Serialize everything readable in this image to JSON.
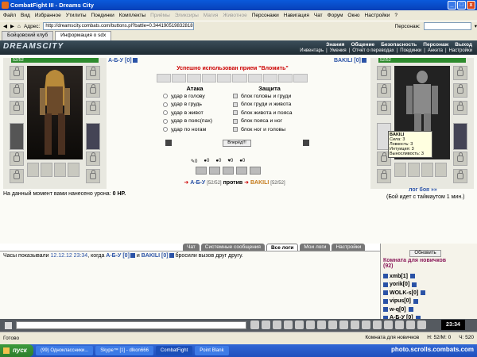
{
  "window": {
    "title": "CombatFight III - Dreams City",
    "minimize": "_",
    "maximize": "□",
    "close": "x"
  },
  "menu": [
    {
      "label": "Файл",
      "dim": false
    },
    {
      "label": "Вид",
      "dim": false
    },
    {
      "label": "Избранное",
      "dim": false
    },
    {
      "label": "Утилиты",
      "dim": false
    },
    {
      "label": "Поединки",
      "dim": false
    },
    {
      "label": "Комплекты",
      "dim": false
    },
    {
      "label": "Приёмы",
      "dim": true
    },
    {
      "label": "Эликсиры",
      "dim": true
    },
    {
      "label": "Магия",
      "dim": true
    },
    {
      "label": "Животное",
      "dim": true
    },
    {
      "label": "Персонажи",
      "dim": false
    },
    {
      "label": "Навигация",
      "dim": false
    },
    {
      "label": "Чат",
      "dim": false
    },
    {
      "label": "Форум",
      "dim": false
    },
    {
      "label": "Окно",
      "dim": false
    },
    {
      "label": "Настройки",
      "dim": false
    },
    {
      "label": "?",
      "dim": false
    }
  ],
  "address": {
    "label": "Адрес:",
    "url": "http://dreamscity.combats.com/buttons.pl?battle=0.344190519832818",
    "persons_label": "Персонаж:"
  },
  "tabs": [
    {
      "label": "Бойцовский клуб"
    },
    {
      "label": "Информация о sdx"
    }
  ],
  "game": {
    "logo": "DREAMSCITY",
    "nav_top": [
      "Знания",
      "Общение",
      "Безопасность",
      "Персонаж",
      "Выход"
    ],
    "nav_sub": [
      "Инвентарь",
      "Умения",
      "Отчет о переводах",
      "Поединки",
      "Анкета",
      "Настройки"
    ]
  },
  "left_player": {
    "name": "А-Б-У [0]",
    "hp": "52/52"
  },
  "right_player": {
    "name": "BAKILI [0]",
    "hp": "52/52",
    "tooltip": {
      "name": "BAKILI",
      "str": "Сила: 3",
      "agi": "Ловкость: 3",
      "int": "Интуиция: 3",
      "vit": "Выносливость: 3"
    }
  },
  "battle": {
    "success": "Успешно использован прием \"Вломить\"",
    "attack_header": "Атака",
    "defense_header": "Защита",
    "attacks": [
      "удар в голову",
      "удар в грудь",
      "удар в живот",
      "удар в пояс(пах)",
      "удар по ногам"
    ],
    "defenses": [
      "блок головы и груди",
      "блок груди и живота",
      "блок живота и пояса",
      "блок пояса и ног",
      "блок ног и головы"
    ],
    "forward": "Вперёд!!!",
    "counts": [
      "0",
      "0",
      "0",
      "0",
      "0"
    ],
    "vs_left": "А-Б-У",
    "vs_left_hp": "[52/52]",
    "vs_word": "против",
    "vs_right": "BAKILI",
    "vs_right_hp": "[52/52]",
    "damage_text": "На данный момент вами нанесено урона:",
    "damage_value": "0 HP.",
    "log_link": "лог боя »»",
    "timeout": "(Бой идет с таймаутом 1 мин.)"
  },
  "chat": {
    "tabs": [
      "Чат",
      "Системные сообщения",
      "Все логи",
      "Мои логи",
      "Настройки"
    ],
    "active_tab": "Все логи",
    "line_prefix": "Часы показывали",
    "line_time": "12.12.12 23:34",
    "line_mid": ", когда",
    "line_p1": "А-Б-У [0]",
    "line_and": "и",
    "line_p2": "BAKILI [0]",
    "line_end": "бросили вызов друг другу."
  },
  "side": {
    "refresh": "Обновить",
    "room": "Комната для новичков",
    "count": "(92)",
    "users": [
      "xmb[1]",
      "yorik[0]",
      "WOLK-s[0]",
      "vipus[0]",
      "w-q[0]",
      "А-Б-У [0]"
    ]
  },
  "toolbar": {
    "clock": "23:34"
  },
  "status": {
    "left": "Готово",
    "room": "Комната для новичков",
    "stats": "Н: 52/М: 0",
    "extra": "Ч: 520"
  },
  "taskbar": {
    "start": "пуск",
    "items": [
      "(99) Одноклассники...",
      "Skype™ [1] - dlkon666",
      "CombatFight",
      "Point Blank"
    ]
  },
  "watermark": "photo.scrolls.combats.com"
}
